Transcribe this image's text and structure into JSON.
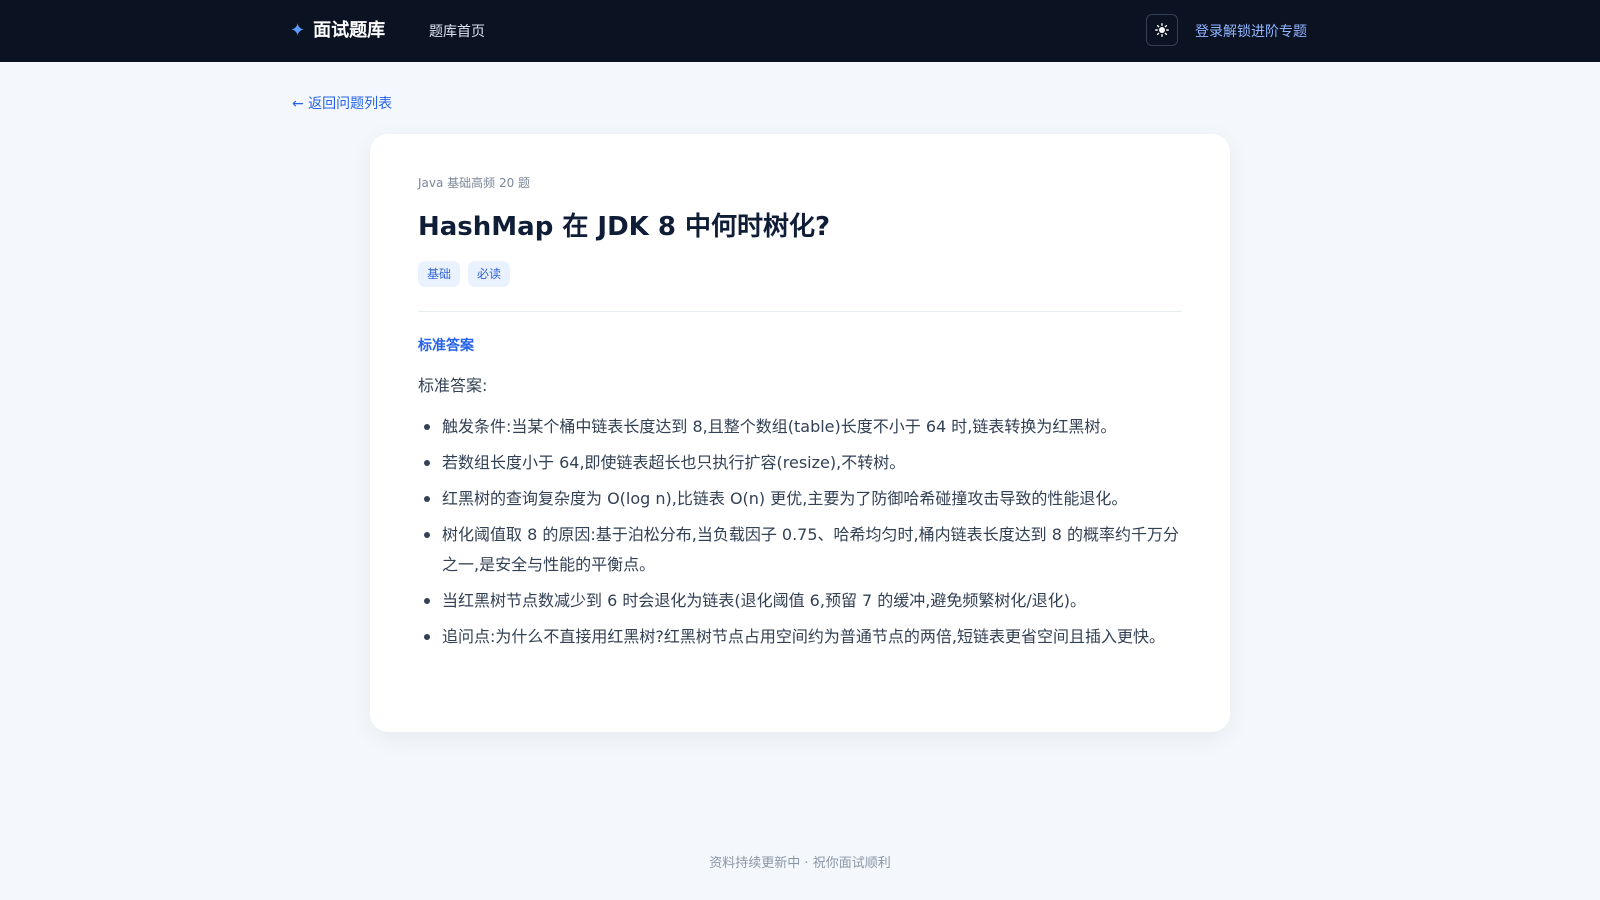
{
  "header": {
    "brand_icon": "sparkle-icon",
    "brand_star": "✦",
    "brand_name": "面试题库",
    "nav_home": "题库首页",
    "theme_toggle_icon": "sun-icon",
    "login_link": "登录解锁进阶专题"
  },
  "back_link": "← 返回问题列表",
  "question": {
    "collection": "Java 基础高频 20 题",
    "title": "HashMap 在 JDK 8 中何时树化?",
    "tags": [
      "基础",
      "必读"
    ],
    "section_label": "标准答案",
    "intro": "标准答案:",
    "points": [
      "触发条件:当某个桶中链表长度达到 8,且整个数组(table)长度不小于 64 时,链表转换为红黑树。",
      "若数组长度小于 64,即使链表超长也只执行扩容(resize),不转树。",
      "红黑树的查询复杂度为 O(log n),比链表 O(n) 更优,主要为了防御哈希碰撞攻击导致的性能退化。",
      "树化阈值取 8 的原因:基于泊松分布,当负载因子 0.75、哈希均匀时,桶内链表长度达到 8 的概率约千万分之一,是安全与性能的平衡点。",
      "当红黑树节点数减少到 6 时会退化为链表(退化阈值 6,预留 7 的缓冲,避免频繁树化/退化)。",
      "追问点:为什么不直接用红黑树?红黑树节点占用空间约为普通节点的两倍,短链表更省空间且插入更快。"
    ]
  },
  "footer": "资料持续更新中 · 祝你面试顺利",
  "colors": {
    "header_bg": "#0b1222",
    "accent": "#2563eb",
    "page_bg": "#f4f7fb",
    "tag_bg": "#eaf1ff"
  }
}
